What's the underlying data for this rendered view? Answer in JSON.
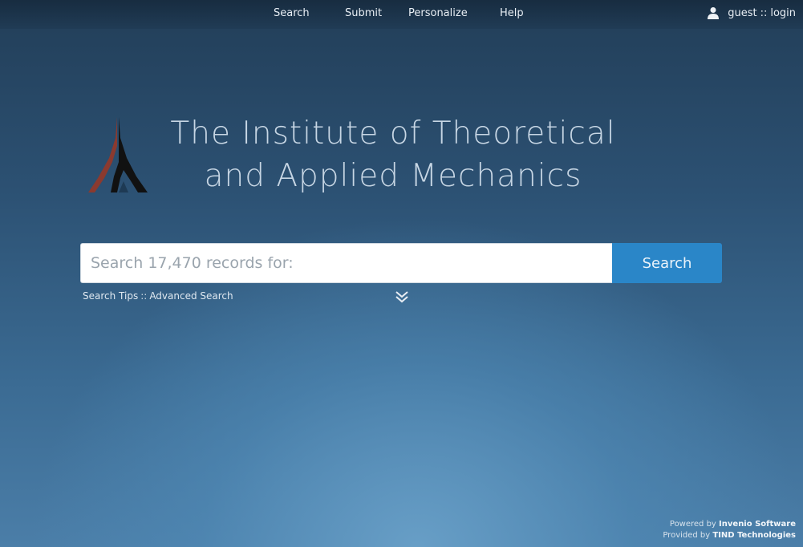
{
  "nav": {
    "items": [
      {
        "label": "Search"
      },
      {
        "label": "Submit"
      },
      {
        "label": "Personalize"
      },
      {
        "label": "Help"
      }
    ],
    "user": {
      "name": "guest",
      "separator": "::",
      "login": "login"
    }
  },
  "header": {
    "title_line1": "The Institute of Theoretical",
    "title_line2": "and Applied Mechanics",
    "logo_icon": "tower-logo-icon"
  },
  "search": {
    "placeholder": "Search 17,470 records for:",
    "value": "",
    "button_label": "Search",
    "tips_label": "Search Tips",
    "separator": "::",
    "advanced_label": "Advanced Search",
    "expand_icon": "double-chevron-down-icon"
  },
  "footer": {
    "powered_prefix": "Powered by",
    "powered_name": "Invenio Software",
    "provided_prefix": "Provided by",
    "provided_name": "TIND Technologies"
  },
  "colors": {
    "accent": "#2a86c8",
    "logo_red": "#8b3a2f",
    "logo_black": "#111111"
  }
}
